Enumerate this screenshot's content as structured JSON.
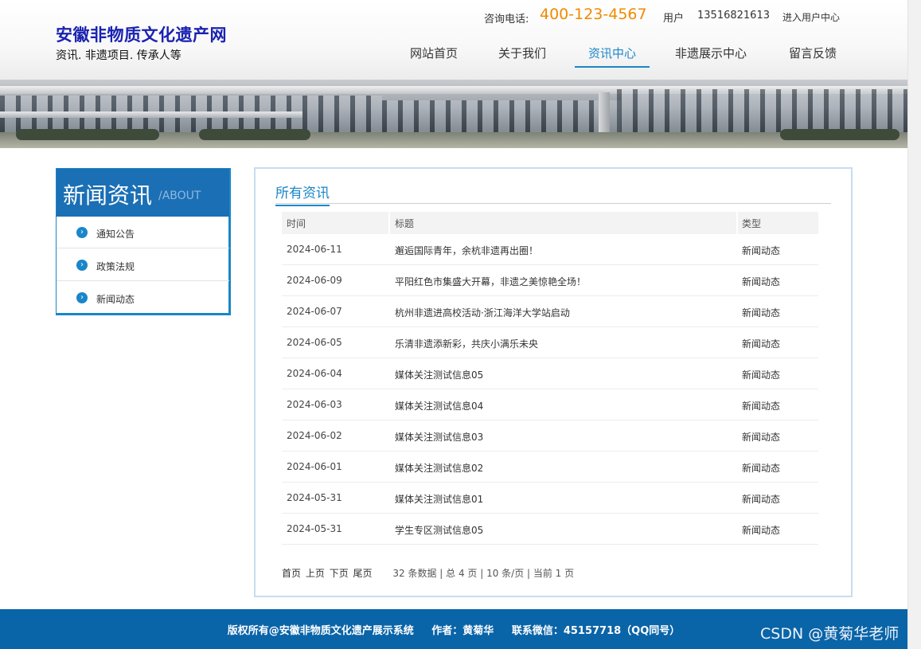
{
  "header": {
    "site_title": "安徽非物质文化遗产网",
    "site_subtitle": "资讯. 非遗项目. 传承人等",
    "hotline_label": "咨询电话:",
    "hotline_number": "400-123-4567",
    "user_label": "用户",
    "user_phone": "13516821613",
    "user_center_link": "进入用户中心"
  },
  "nav": [
    {
      "label": "网站首页",
      "active": false
    },
    {
      "label": "关于我们",
      "active": false
    },
    {
      "label": "资讯中心",
      "active": true
    },
    {
      "label": "非遗展示中心",
      "active": false
    },
    {
      "label": "留言反馈",
      "active": false
    }
  ],
  "sidebar": {
    "title": "新闻资讯",
    "title_en": "/ABOUT",
    "items": [
      {
        "label": "通知公告",
        "icon": "chevron-right-icon"
      },
      {
        "label": "政策法规",
        "icon": "chevron-right-icon"
      },
      {
        "label": "新闻动态",
        "icon": "chevron-right-icon"
      }
    ]
  },
  "main": {
    "title": "所有资讯",
    "columns": [
      "时间",
      "标题",
      "类型"
    ],
    "rows": [
      {
        "date": "2024-06-11",
        "title": "邂逅国际青年，余杭非遗再出圈！",
        "type": "新闻动态"
      },
      {
        "date": "2024-06-09",
        "title": "平阳红色市集盛大开幕，非遗之美惊艳全场！",
        "type": "新闻动态"
      },
      {
        "date": "2024-06-07",
        "title": "杭州非遗进高校活动·浙江海洋大学站启动",
        "type": "新闻动态"
      },
      {
        "date": "2024-06-05",
        "title": "乐清非遗添新彩，共庆小满乐未央",
        "type": "新闻动态"
      },
      {
        "date": "2024-06-04",
        "title": "媒体关注测试信息05",
        "type": "新闻动态"
      },
      {
        "date": "2024-06-03",
        "title": "媒体关注测试信息04",
        "type": "新闻动态"
      },
      {
        "date": "2024-06-02",
        "title": "媒体关注测试信息03",
        "type": "新闻动态"
      },
      {
        "date": "2024-06-01",
        "title": "媒体关注测试信息02",
        "type": "新闻动态"
      },
      {
        "date": "2024-05-31",
        "title": "媒体关注测试信息01",
        "type": "新闻动态"
      },
      {
        "date": "2024-05-31",
        "title": "学生专区测试信息05",
        "type": "新闻动态"
      }
    ],
    "pager": {
      "first": "首页",
      "prev": "上页",
      "next": "下页",
      "last": "尾页",
      "info": "32 条数据 | 总 4 页 | 10 条/页 | 当前 1 页"
    }
  },
  "footer": {
    "copyright": "版权所有@安徽非物质文化遗产展示系统",
    "author": "作者：黄菊华",
    "contact": "联系微信：45157718（QQ同号）"
  },
  "watermark": "CSDN @黄菊华老师",
  "colors": {
    "brand_blue": "#1b6fb5",
    "link_blue": "#1a86c8",
    "title_navy": "#1a23b0",
    "hotline_orange": "#f08a00",
    "footer_blue": "#0a64a8"
  }
}
